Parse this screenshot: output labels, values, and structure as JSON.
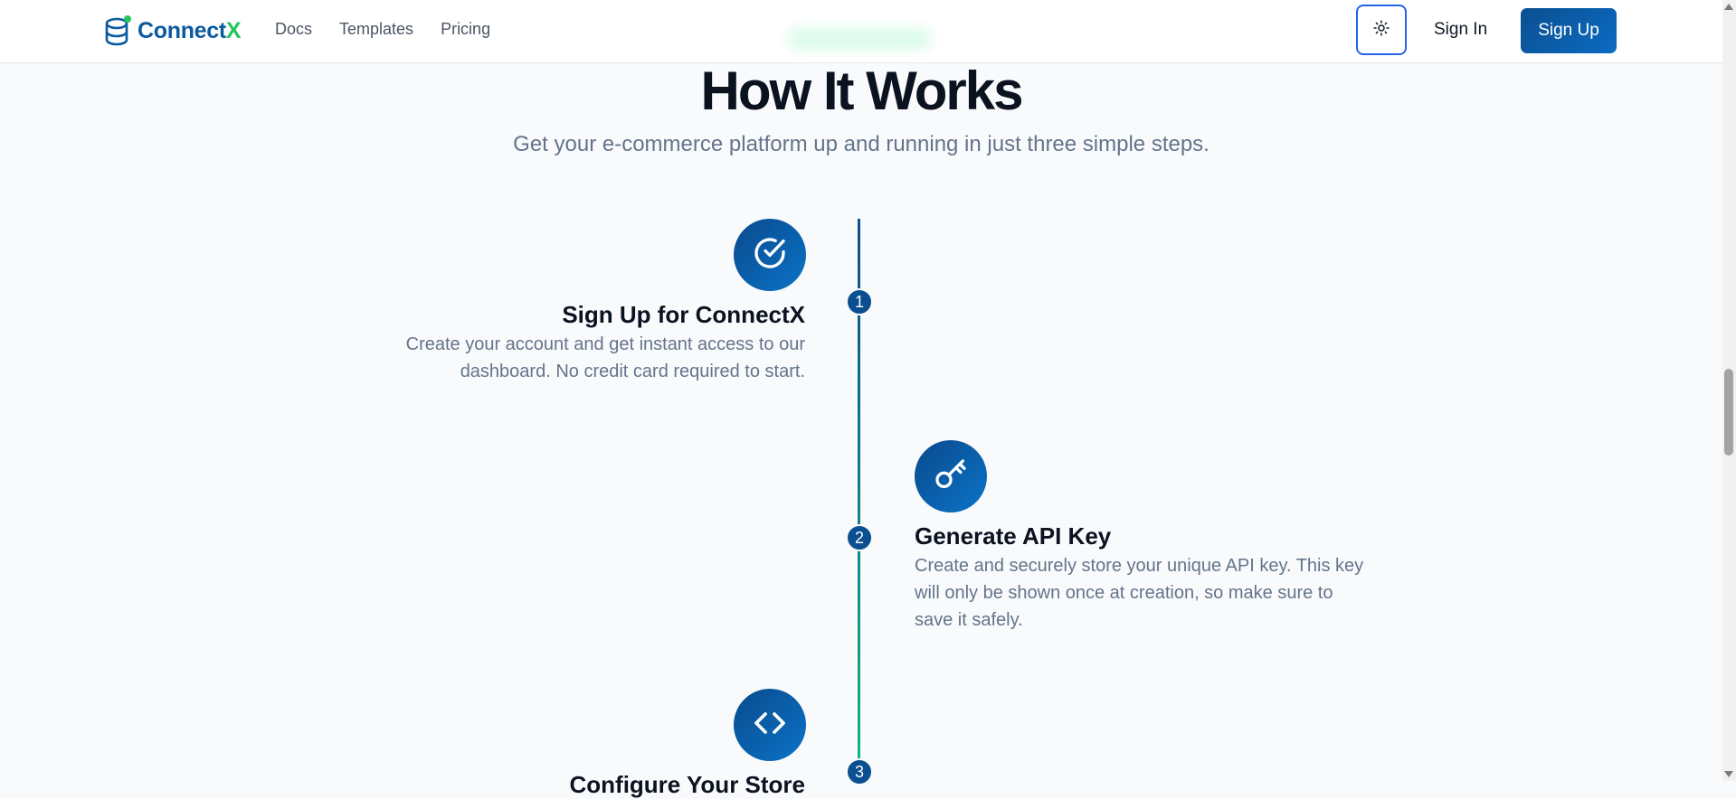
{
  "header": {
    "logo": {
      "part1": "Connect",
      "part2": "X",
      "icon": "database-icon"
    },
    "nav": [
      {
        "label": "Docs"
      },
      {
        "label": "Templates"
      },
      {
        "label": "Pricing"
      }
    ],
    "theme_toggle_icon": "sun-icon",
    "sign_in": "Sign In",
    "sign_up": "Sign Up"
  },
  "section": {
    "title": "How It Works",
    "subtitle": "Get your e-commerce platform up and running in just three simple steps.",
    "steps": [
      {
        "number": "1",
        "icon": "check-circle-icon",
        "title": "Sign Up for ConnectX",
        "description": "Create your account and get instant access to our dashboard. No credit card required to start."
      },
      {
        "number": "2",
        "icon": "key-icon",
        "title": "Generate API Key",
        "description": "Create and securely store your unique API key. This key will only be shown once at creation, so make sure to save it safely."
      },
      {
        "number": "3",
        "icon": "code-icon",
        "title": "Configure Your Store",
        "description": ""
      }
    ]
  },
  "colors": {
    "brand_primary": "#0b5aa0",
    "brand_accent": "#22c55e",
    "timeline_end": "#10b981"
  }
}
